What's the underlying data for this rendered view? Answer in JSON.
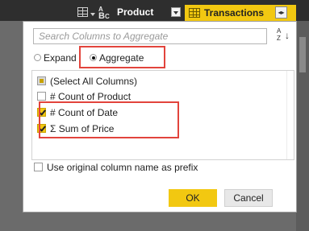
{
  "header": {
    "column_name": "Product",
    "column_type_icon": "abc-text-type-icon",
    "table_icon": "table-icon",
    "transactions_label": "Transactions",
    "expand_icon": "expand-columns-icon",
    "accent_color": "#f2c811"
  },
  "popup": {
    "search_placeholder": "Search Columns to Aggregate",
    "sort_icon": "sort-az-icon",
    "mode_options": [
      {
        "label": "Expand",
        "selected": false
      },
      {
        "label": "Aggregate",
        "selected": true
      }
    ],
    "columns": [
      {
        "label": "(Select All Columns)",
        "state": "partial"
      },
      {
        "label": "# Count of Product",
        "state": "unchecked"
      },
      {
        "label": "# Count of Date",
        "state": "checked"
      },
      {
        "label": "Σ Sum of Price",
        "state": "checked"
      }
    ],
    "prefix_label": "Use original column name as prefix",
    "prefix_checked": false,
    "ok_label": "OK",
    "cancel_label": "Cancel",
    "highlight_color": "#e2443c"
  }
}
